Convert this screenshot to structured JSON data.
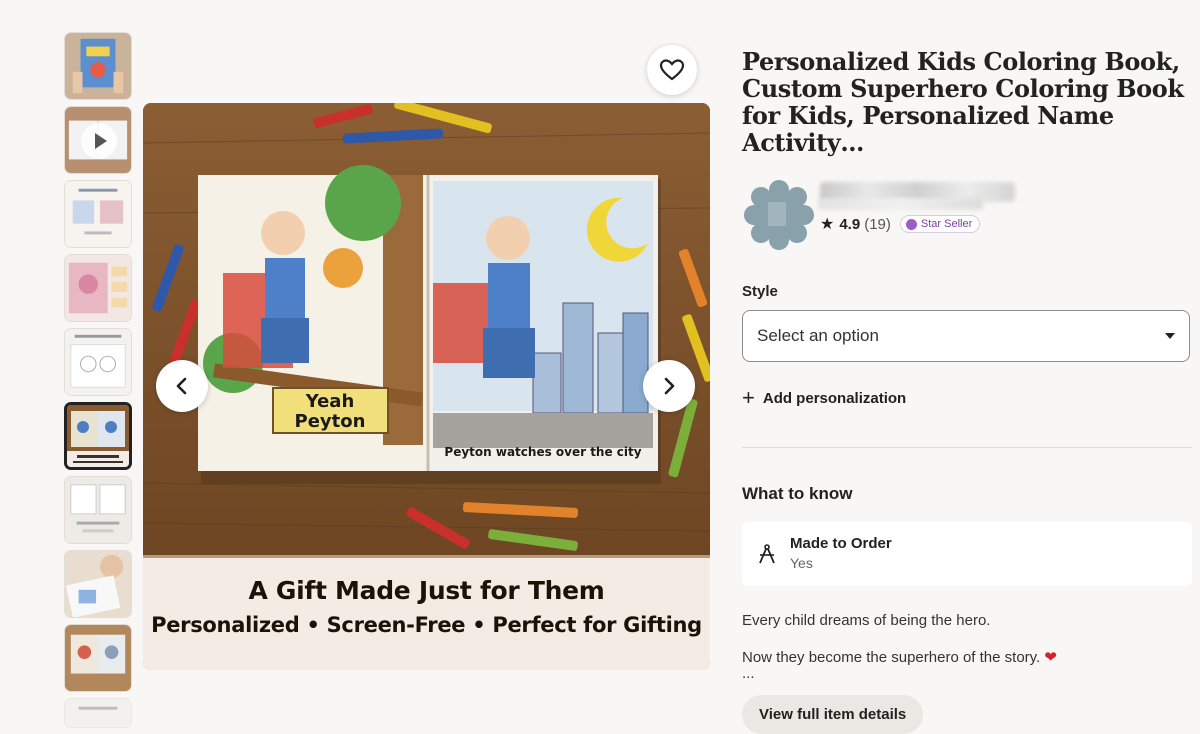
{
  "thumbnails": [
    {
      "label": "Superhero coloring book cover"
    },
    {
      "label": "Video preview",
      "video": true
    },
    {
      "label": "Make them the hero of the story"
    },
    {
      "label": "Sample pages"
    },
    {
      "label": "The perfect gift"
    },
    {
      "label": "Book spread",
      "selected": true
    },
    {
      "label": "Activity pages"
    },
    {
      "label": "Kid coloring"
    },
    {
      "label": "Pages preview"
    },
    {
      "label": "Shop Policies"
    }
  ],
  "main_image": {
    "book_left_sign": "Yeah Peyton",
    "book_right_caption": "Peyton watches over the city",
    "banner_title": "A Gift Made Just for Them",
    "banner_subtitle": "Personalized • Screen-Free • Perfect for Gifting"
  },
  "listing": {
    "title": "Personalized Kids Coloring Book, Custom Superhero Coloring Book for Kids, Personalized Name Activity…",
    "rating": "4.9",
    "review_count": "(19)",
    "badge": "Star Seller"
  },
  "style": {
    "label": "Style",
    "select_value": "Select an option"
  },
  "personalization": {
    "label": "Add personalization"
  },
  "what_to_know": {
    "heading": "What to know",
    "card_title": "Made to Order",
    "card_value": "Yes"
  },
  "description": {
    "line1": "Every child dreams of being the hero.",
    "line2": "Now they become the superhero of the story. ",
    "heart": "❤",
    "ellipsis": "..."
  },
  "view_details_label": "View full item details",
  "colors": {
    "accent_purple": "#7b3fa5",
    "background": "#f8f7f5"
  }
}
